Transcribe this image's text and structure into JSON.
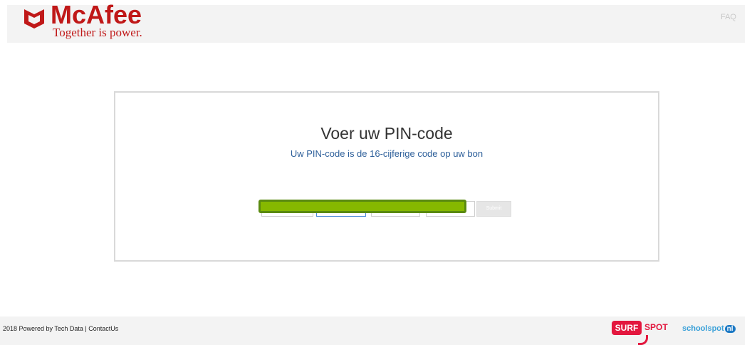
{
  "header": {
    "brand": "McAfee",
    "tagline": "Together is power.",
    "faq_link": "FAQ",
    "brand_color": "#c01818"
  },
  "card": {
    "title": "Voer uw PIN-code",
    "subtitle": "Uw PIN-code is de 16-cijferige code op uw bon",
    "pin_fields": [
      "",
      "",
      "",
      ""
    ],
    "submit_label": "Submit",
    "highlight_color": "#86b800"
  },
  "footer": {
    "copyright": "2018 Powered by Tech Data | ",
    "contact_link": "ContactUs",
    "surf_label": "SURF",
    "spot_label": "SPOT",
    "schoolspot_label": "schoolspot",
    "schoolspot_tld": "nl",
    "surfspot_color": "#e3173e",
    "schoolspot_color": "#3aa0d8"
  }
}
